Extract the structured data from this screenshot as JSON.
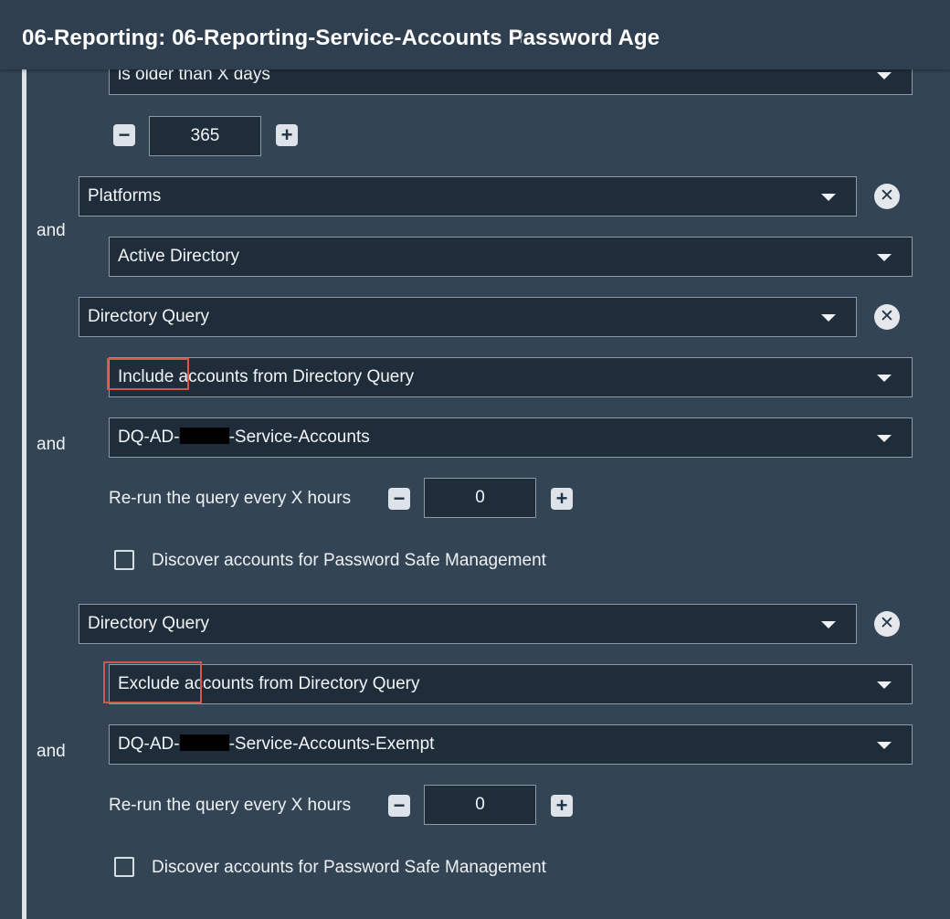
{
  "header": {
    "title": "06-Reporting: 06-Reporting-Service-Accounts Password Age"
  },
  "rule1": {
    "condition": "is older than X days",
    "days": "365"
  },
  "connector": "and",
  "platforms": {
    "field": "Platforms",
    "value": "Active Directory"
  },
  "dq1": {
    "field": "Directory Query",
    "mode": "Include accounts from Directory Query",
    "query_prefix": "DQ-AD-",
    "query_suffix": "-Service-Accounts",
    "rerun_label": "Re-run the query every X hours",
    "rerun_value": "0",
    "discover_label": "Discover accounts for Password Safe Management"
  },
  "dq2": {
    "field": "Directory Query",
    "mode": "Exclude accounts from Directory Query",
    "query_prefix": "DQ-AD-",
    "query_suffix": "-Service-Accounts-Exempt",
    "rerun_label": "Re-run the query every X hours",
    "rerun_value": "0",
    "discover_label": "Discover accounts for Password Safe Management"
  },
  "icons": {
    "minus": "minus-icon",
    "plus": "plus-icon",
    "remove": "remove-circle-icon",
    "dropdown": "chevron-down-icon"
  },
  "colors": {
    "background": "#334455",
    "field": "#1f2d3b",
    "highlight": "#d9534f"
  }
}
